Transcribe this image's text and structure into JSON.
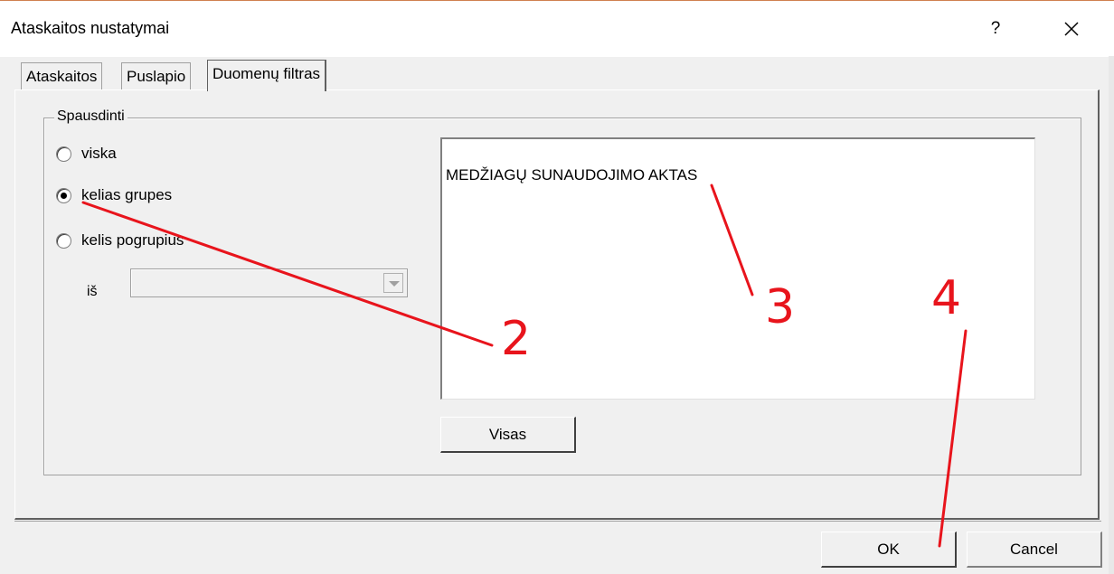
{
  "window": {
    "title": "Ataskaitos nustatymai",
    "help_label": "?",
    "close_icon": "close-icon"
  },
  "tabs": [
    {
      "label": "Ataskaitos",
      "active": false
    },
    {
      "label": "Puslapio",
      "active": false
    },
    {
      "label": "Duomenų filtras",
      "active": true
    }
  ],
  "group": {
    "legend": "Spausdinti",
    "options": [
      {
        "label": "viska",
        "selected": false
      },
      {
        "label": "kelias grupes",
        "selected": true
      },
      {
        "label": "kelis pogrupius",
        "selected": false
      }
    ],
    "from_label": "iš",
    "from_value": ""
  },
  "list": {
    "items": [
      "MEDŽIAGŲ SUNAUDOJIMO AKTAS"
    ]
  },
  "buttons": {
    "all_label": "Visas",
    "ok_label": "OK",
    "cancel_label": "Cancel"
  },
  "annotations": {
    "color": "#e8141c",
    "labels": [
      "2",
      "3",
      "4"
    ]
  }
}
